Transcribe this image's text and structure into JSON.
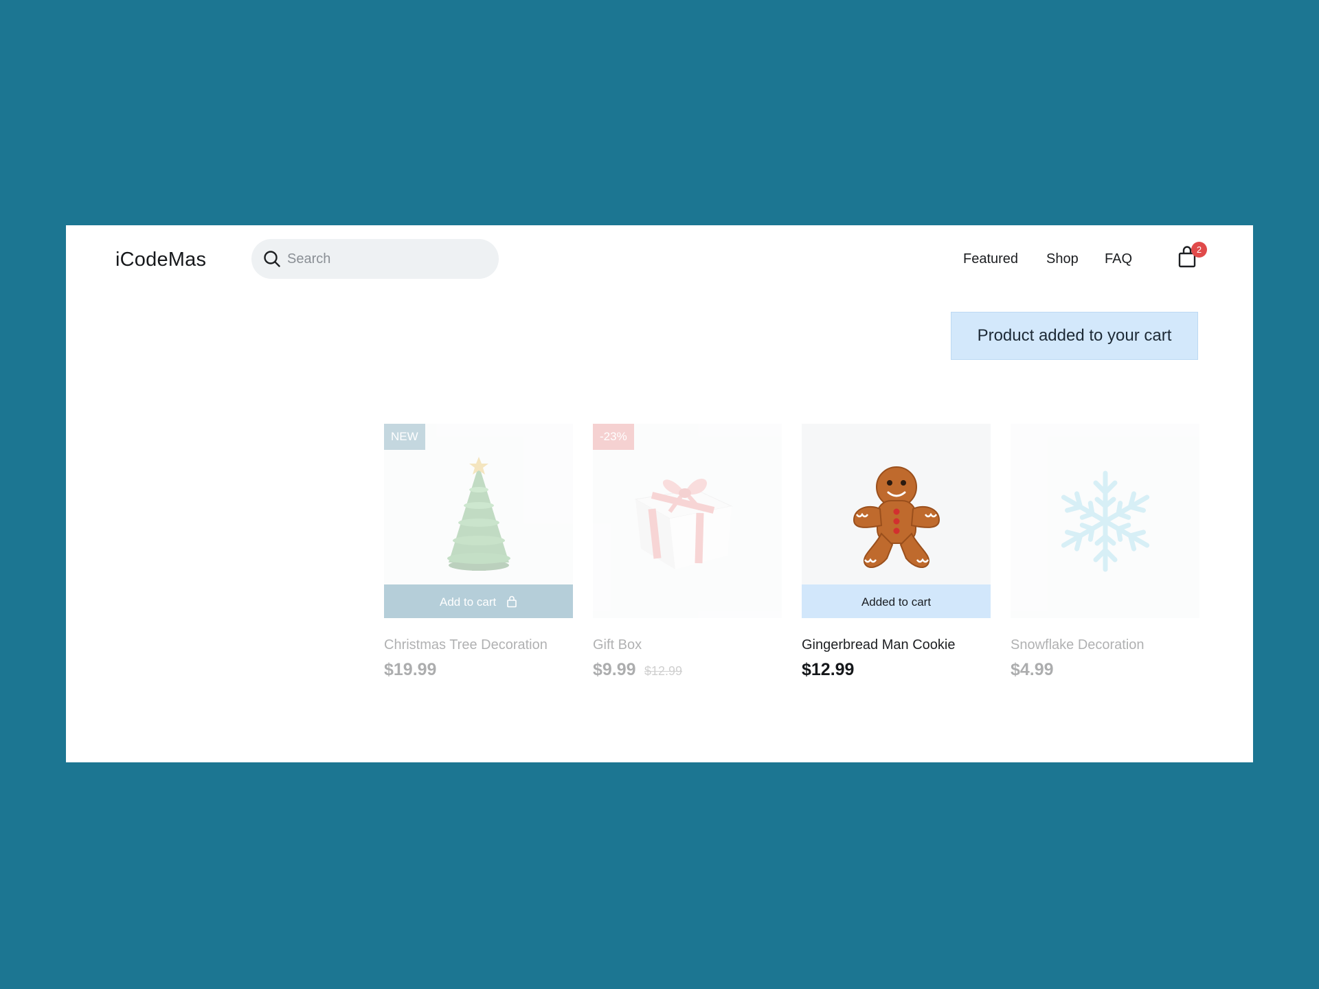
{
  "header": {
    "logo": "iCodeMas",
    "search": {
      "placeholder": "Search",
      "value": ""
    },
    "nav": [
      "Featured",
      "Shop",
      "FAQ"
    ],
    "cart_count": "2"
  },
  "toast": {
    "message": "Product added to your cart"
  },
  "products": [
    {
      "name": "Christmas Tree Decoration",
      "price": "$19.99",
      "badge": "NEW",
      "button": "Add to cart",
      "image_icon": "christmas-tree-icon"
    },
    {
      "name": "Gift Box",
      "price": "$9.99",
      "old_price": "$12.99",
      "badge": "-23%",
      "image_icon": "gift-box-icon"
    },
    {
      "name": "Gingerbread Man Cookie",
      "price": "$12.99",
      "button": "Added to cart",
      "image_icon": "gingerbread-man-icon"
    },
    {
      "name": "Snowflake Decoration",
      "price": "$4.99",
      "image_icon": "snowflake-icon"
    }
  ],
  "colors": {
    "background": "#1c7692",
    "toast": "#d3e8fb",
    "badge_new": "#5a8fa6",
    "badge_sale": "#e47d7d",
    "cart_badge": "#e04a4a"
  }
}
